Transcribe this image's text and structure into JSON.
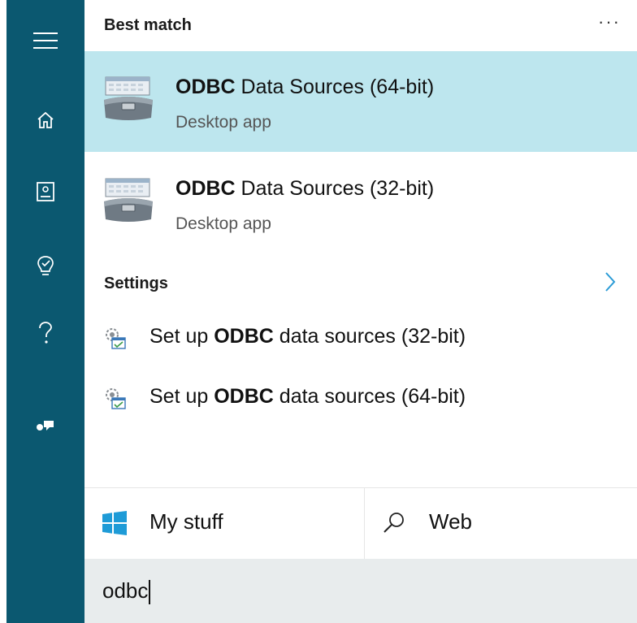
{
  "sidebar": {
    "items": [
      {
        "name": "menu"
      },
      {
        "name": "home"
      },
      {
        "name": "notebook"
      },
      {
        "name": "reminders"
      },
      {
        "name": "help"
      },
      {
        "name": "feedback"
      }
    ]
  },
  "best_match": {
    "header": "Best match",
    "more_label": "···",
    "results": [
      {
        "title_bold": "ODBC",
        "title_rest": " Data Sources (64-bit)",
        "subtitle": "Desktop app",
        "selected": true,
        "icon": "odbc-admin-icon"
      },
      {
        "title_bold": "ODBC",
        "title_rest": " Data Sources (32-bit)",
        "subtitle": "Desktop app",
        "selected": false,
        "icon": "odbc-admin-icon"
      }
    ]
  },
  "settings": {
    "header": "Settings",
    "items": [
      {
        "prefix": "Set up ",
        "bold": "ODBC",
        "suffix": " data sources (32-bit)",
        "icon": "settings-gear-icon"
      },
      {
        "prefix": "Set up ",
        "bold": "ODBC",
        "suffix": " data sources (64-bit)",
        "icon": "settings-gear-icon"
      }
    ]
  },
  "filters": {
    "my_stuff": "My stuff",
    "web": "Web"
  },
  "search": {
    "query": "odbc"
  },
  "colors": {
    "sidebar": "#0b5870",
    "selected": "#bde6ee",
    "searchbox": "#e8eced"
  }
}
